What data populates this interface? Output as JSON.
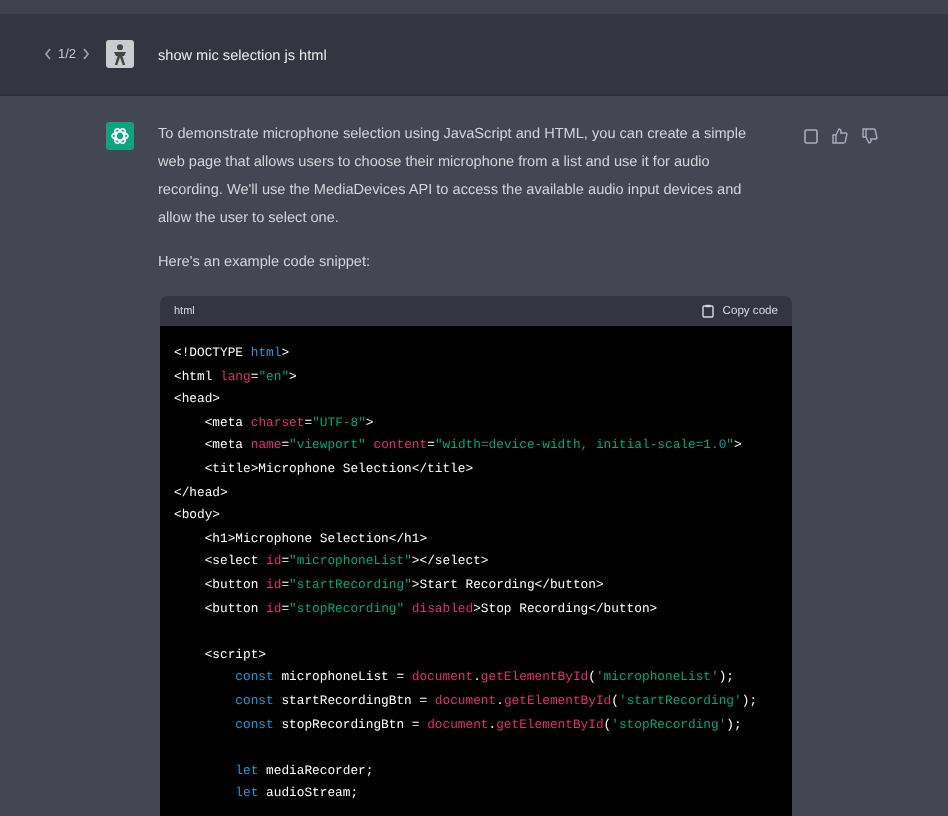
{
  "prompt": {
    "pager": "1/2",
    "text": "show mic selection js html"
  },
  "response": {
    "paragraphs": [
      "To demonstrate microphone selection using JavaScript and HTML, you can create a simple web page that allows users to choose their microphone from a list and use it for audio recording. We'll use the MediaDevices API to access the available audio input devices and allow the user to select one.",
      "Here's an example code snippet:"
    ],
    "code_block": {
      "language": "html",
      "copy_label": "Copy code",
      "lines": [
        {
          "kind": "code",
          "tokens": [
            {
              "kind": "plain",
              "text": "<!DOCTYPE "
            },
            {
              "kind": "keyword",
              "text": "html"
            },
            {
              "kind": "plain",
              "text": ">"
            }
          ]
        },
        {
          "kind": "code",
          "tokens": [
            {
              "kind": "plain",
              "text": "<html "
            },
            {
              "kind": "attr",
              "text": "lang"
            },
            {
              "kind": "plain",
              "text": "="
            },
            {
              "kind": "string",
              "text": "\"en\""
            },
            {
              "kind": "plain",
              "text": ">"
            }
          ]
        },
        {
          "kind": "code",
          "tokens": [
            {
              "kind": "plain",
              "text": "<head>"
            }
          ]
        },
        {
          "kind": "code",
          "tokens": [
            {
              "kind": "plain",
              "text": "    <meta "
            },
            {
              "kind": "attr",
              "text": "charset"
            },
            {
              "kind": "plain",
              "text": "="
            },
            {
              "kind": "string",
              "text": "\"UTF-8\""
            },
            {
              "kind": "plain",
              "text": ">"
            }
          ]
        },
        {
          "kind": "code",
          "tokens": [
            {
              "kind": "plain",
              "text": "    <meta "
            },
            {
              "kind": "attr",
              "text": "name"
            },
            {
              "kind": "plain",
              "text": "="
            },
            {
              "kind": "string",
              "text": "\"viewport\""
            },
            {
              "kind": "attr",
              "text": " content"
            },
            {
              "kind": "plain",
              "text": "="
            },
            {
              "kind": "string",
              "text": "\"width=device-width, initial-scale=1.0\""
            },
            {
              "kind": "plain",
              "text": ">"
            }
          ]
        },
        {
          "kind": "code",
          "tokens": [
            {
              "kind": "plain",
              "text": "    <title>Microphone Selection</title>"
            }
          ]
        },
        {
          "kind": "code",
          "tokens": [
            {
              "kind": "plain",
              "text": "</head>"
            }
          ]
        },
        {
          "kind": "code",
          "tokens": [
            {
              "kind": "plain",
              "text": "<body>"
            }
          ]
        },
        {
          "kind": "code",
          "tokens": [
            {
              "kind": "plain",
              "text": "    <h1>Microphone Selection</h1>"
            }
          ]
        },
        {
          "kind": "code",
          "tokens": [
            {
              "kind": "plain",
              "text": "    <select "
            },
            {
              "kind": "attr",
              "text": "id"
            },
            {
              "kind": "plain",
              "text": "="
            },
            {
              "kind": "string",
              "text": "\"microphoneList\""
            },
            {
              "kind": "plain",
              "text": "></select>"
            }
          ]
        },
        {
          "kind": "code",
          "tokens": [
            {
              "kind": "plain",
              "text": "    <button "
            },
            {
              "kind": "attr",
              "text": "id"
            },
            {
              "kind": "plain",
              "text": "="
            },
            {
              "kind": "string",
              "text": "\"startRecording\""
            },
            {
              "kind": "plain",
              "text": ">Start Recording</button>"
            }
          ]
        },
        {
          "kind": "code",
          "tokens": [
            {
              "kind": "plain",
              "text": "    <button "
            },
            {
              "kind": "attr",
              "text": "id"
            },
            {
              "kind": "plain",
              "text": "="
            },
            {
              "kind": "string",
              "text": "\"stopRecording\""
            },
            {
              "kind": "attr",
              "text": " disabled"
            },
            {
              "kind": "plain",
              "text": ">Stop Recording</button>"
            }
          ]
        },
        {
          "kind": "blank"
        },
        {
          "kind": "code",
          "tokens": [
            {
              "kind": "plain",
              "text": "    <script>"
            }
          ]
        },
        {
          "kind": "code",
          "tokens": [
            {
              "kind": "keyword",
              "text": "        const"
            },
            {
              "kind": "plain",
              "text": " microphoneList = "
            },
            {
              "kind": "attr",
              "text": "document"
            },
            {
              "kind": "plain",
              "text": "."
            },
            {
              "kind": "attr",
              "text": "getElementById"
            },
            {
              "kind": "plain",
              "text": "("
            },
            {
              "kind": "string",
              "text": "'microphoneList'"
            },
            {
              "kind": "plain",
              "text": ");"
            }
          ]
        },
        {
          "kind": "code",
          "tokens": [
            {
              "kind": "keyword",
              "text": "        const"
            },
            {
              "kind": "plain",
              "text": " startRecordingBtn = "
            },
            {
              "kind": "attr",
              "text": "document"
            },
            {
              "kind": "plain",
              "text": "."
            },
            {
              "kind": "attr",
              "text": "getElementById"
            },
            {
              "kind": "plain",
              "text": "("
            },
            {
              "kind": "string",
              "text": "'startRecording'"
            },
            {
              "kind": "plain",
              "text": ");"
            }
          ]
        },
        {
          "kind": "code",
          "tokens": [
            {
              "kind": "keyword",
              "text": "        const"
            },
            {
              "kind": "plain",
              "text": " stopRecordingBtn = "
            },
            {
              "kind": "attr",
              "text": "document"
            },
            {
              "kind": "plain",
              "text": "."
            },
            {
              "kind": "attr",
              "text": "getElementById"
            },
            {
              "kind": "plain",
              "text": "("
            },
            {
              "kind": "string",
              "text": "'stopRecording'"
            },
            {
              "kind": "plain",
              "text": ");"
            }
          ]
        },
        {
          "kind": "blank"
        },
        {
          "kind": "code",
          "tokens": [
            {
              "kind": "keyword",
              "text": "        let"
            },
            {
              "kind": "plain",
              "text": " mediaRecorder;"
            }
          ]
        },
        {
          "kind": "code",
          "tokens": [
            {
              "kind": "keyword",
              "text": "        let"
            },
            {
              "kind": "plain",
              "text": " audioStream;"
            }
          ]
        }
      ]
    }
  }
}
